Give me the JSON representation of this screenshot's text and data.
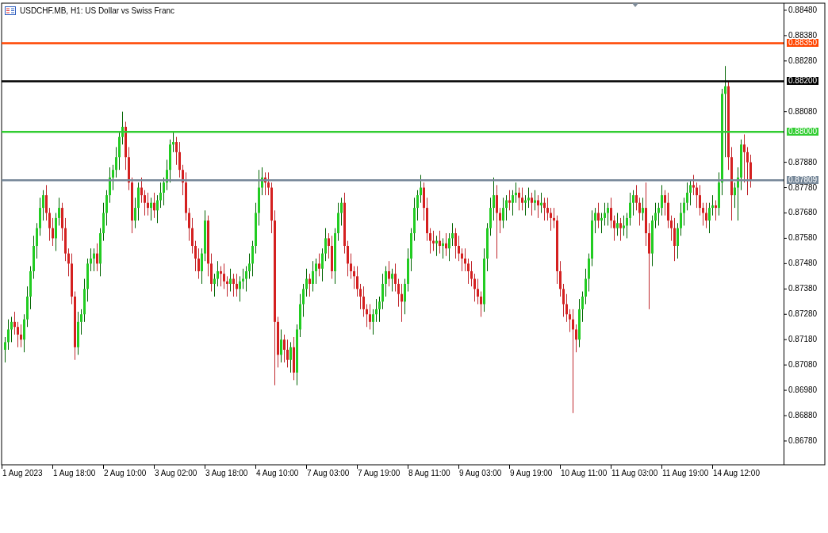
{
  "chart_title": "USDCHF.MB, H1:  US Dollar vs Swiss Franc",
  "time_axis": [
    "1 Aug 2023",
    "1 Aug 18:00",
    "2 Aug 10:00",
    "3 Aug 02:00",
    "3 Aug 18:00",
    "4 Aug 10:00",
    "7 Aug 03:00",
    "7 Aug 19:00",
    "8 Aug 11:00",
    "9 Aug 03:00",
    "9 Aug 19:00",
    "10 Aug 11:00",
    "11 Aug 03:00",
    "11 Aug 19:00",
    "14 Aug 12:00"
  ],
  "chart_data": {
    "type": "candlestick",
    "ref_lines": [
      {
        "axis": "y",
        "value": 0.8835,
        "label": "0.88350",
        "color": "#ff4500"
      },
      {
        "axis": "y",
        "value": 0.882,
        "label": "0.88200",
        "color": "#000000"
      },
      {
        "axis": "y",
        "value": 0.88,
        "label": "0.88000",
        "color": "#32cd32"
      },
      {
        "axis": "y",
        "value": 0.87809,
        "label": "0.87809",
        "color": "#778899"
      }
    ],
    "ylim": [
      0.86686,
      0.88508
    ],
    "yticks": [
      {
        "value": 0.8848,
        "label": "0.88480"
      },
      {
        "value": 0.8838,
        "label": "0.88380"
      },
      {
        "value": 0.8828,
        "label": "0.88280"
      },
      {
        "value": 0.8808,
        "label": "0.88080"
      },
      {
        "value": 0.8788,
        "label": "0.87880"
      },
      {
        "value": 0.8778,
        "label": "0.87780"
      },
      {
        "value": 0.8768,
        "label": "0.87680"
      },
      {
        "value": 0.8758,
        "label": "0.87580"
      },
      {
        "value": 0.8748,
        "label": "0.87480"
      },
      {
        "value": 0.8738,
        "label": "0.87380"
      },
      {
        "value": 0.8728,
        "label": "0.87280"
      },
      {
        "value": 0.8718,
        "label": "0.87180"
      },
      {
        "value": 0.8708,
        "label": "0.87080"
      },
      {
        "value": 0.8698,
        "label": "0.86980"
      },
      {
        "value": 0.8688,
        "label": "0.86880"
      },
      {
        "value": 0.8678,
        "label": "0.86780"
      }
    ],
    "ohlc": [
      [
        0.8714,
        0.8719,
        0.8709,
        0.8717
      ],
      [
        0.8717,
        0.8726,
        0.8714,
        0.8722
      ],
      [
        0.8722,
        0.8727,
        0.8717,
        0.8725
      ],
      [
        0.8725,
        0.8729,
        0.872,
        0.8723
      ],
      [
        0.8723,
        0.8725,
        0.8715,
        0.872
      ],
      [
        0.872,
        0.8724,
        0.8715,
        0.8718
      ],
      [
        0.8718,
        0.8728,
        0.8713,
        0.8726
      ],
      [
        0.8726,
        0.8739,
        0.8723,
        0.8735
      ],
      [
        0.8735,
        0.8747,
        0.873,
        0.8745
      ],
      [
        0.8745,
        0.8759,
        0.8742,
        0.8755
      ],
      [
        0.8755,
        0.8764,
        0.875,
        0.8762
      ],
      [
        0.8762,
        0.8774,
        0.8759,
        0.877
      ],
      [
        0.877,
        0.8777,
        0.8765,
        0.8775
      ],
      [
        0.8775,
        0.8779,
        0.8765,
        0.8768
      ],
      [
        0.8768,
        0.877,
        0.8757,
        0.8762
      ],
      [
        0.8762,
        0.8766,
        0.8755,
        0.8758
      ],
      [
        0.8758,
        0.8768,
        0.8753,
        0.8766
      ],
      [
        0.8766,
        0.8774,
        0.8763,
        0.877
      ],
      [
        0.877,
        0.8772,
        0.8757,
        0.8762
      ],
      [
        0.8762,
        0.8766,
        0.8749,
        0.8752
      ],
      [
        0.8752,
        0.8754,
        0.8743,
        0.8748
      ],
      [
        0.8748,
        0.8752,
        0.8732,
        0.8735
      ],
      [
        0.8735,
        0.8737,
        0.871,
        0.8715
      ],
      [
        0.8715,
        0.8729,
        0.8712,
        0.8725
      ],
      [
        0.8725,
        0.873,
        0.872,
        0.8728
      ],
      [
        0.8728,
        0.8742,
        0.8725,
        0.8738
      ],
      [
        0.8738,
        0.875,
        0.8733,
        0.8748
      ],
      [
        0.8748,
        0.8754,
        0.8745,
        0.875
      ],
      [
        0.875,
        0.8754,
        0.8745,
        0.8752
      ],
      [
        0.8752,
        0.8756,
        0.8745,
        0.8748
      ],
      [
        0.8748,
        0.8762,
        0.8743,
        0.876
      ],
      [
        0.876,
        0.8772,
        0.8757,
        0.8768
      ],
      [
        0.8768,
        0.8777,
        0.8763,
        0.8775
      ],
      [
        0.8775,
        0.8786,
        0.8772,
        0.8782
      ],
      [
        0.8782,
        0.8787,
        0.8777,
        0.8785
      ],
      [
        0.8785,
        0.8794,
        0.8782,
        0.879
      ],
      [
        0.879,
        0.88,
        0.8785,
        0.8798
      ],
      [
        0.8798,
        0.8808,
        0.8795,
        0.8802
      ],
      [
        0.8802,
        0.8804,
        0.8785,
        0.879
      ],
      [
        0.879,
        0.8794,
        0.8777,
        0.878
      ],
      [
        0.878,
        0.8782,
        0.876,
        0.8765
      ],
      [
        0.8765,
        0.8774,
        0.8762,
        0.877
      ],
      [
        0.877,
        0.878,
        0.8765,
        0.8778
      ],
      [
        0.8778,
        0.8782,
        0.8772,
        0.8775
      ],
      [
        0.8775,
        0.8777,
        0.8767,
        0.8772
      ],
      [
        0.8772,
        0.8776,
        0.8767,
        0.877
      ],
      [
        0.877,
        0.8774,
        0.8765,
        0.8772
      ],
      [
        0.8772,
        0.8776,
        0.8766,
        0.8769
      ],
      [
        0.8769,
        0.8775,
        0.8764,
        0.8773
      ],
      [
        0.8773,
        0.878,
        0.877,
        0.8776
      ],
      [
        0.8776,
        0.8782,
        0.8771,
        0.878
      ],
      [
        0.878,
        0.8789,
        0.8777,
        0.8785
      ],
      [
        0.8785,
        0.8797,
        0.878,
        0.8795
      ],
      [
        0.8795,
        0.88,
        0.8792,
        0.8796
      ],
      [
        0.8796,
        0.8798,
        0.8787,
        0.8792
      ],
      [
        0.8792,
        0.8796,
        0.8782,
        0.8785
      ],
      [
        0.8785,
        0.8787,
        0.8775,
        0.878
      ],
      [
        0.878,
        0.8784,
        0.8765,
        0.8768
      ],
      [
        0.8768,
        0.877,
        0.8757,
        0.8762
      ],
      [
        0.8762,
        0.8766,
        0.8752,
        0.8755
      ],
      [
        0.8755,
        0.8757,
        0.8745,
        0.875
      ],
      [
        0.875,
        0.8754,
        0.8742,
        0.8745
      ],
      [
        0.8745,
        0.8754,
        0.874,
        0.8752
      ],
      [
        0.8752,
        0.8769,
        0.8749,
        0.8765
      ],
      [
        0.8765,
        0.8767,
        0.8743,
        0.8748
      ],
      [
        0.8748,
        0.8752,
        0.8737,
        0.874
      ],
      [
        0.874,
        0.8744,
        0.8735,
        0.8742
      ],
      [
        0.8742,
        0.8749,
        0.8739,
        0.8745
      ],
      [
        0.8745,
        0.8747,
        0.8739,
        0.8744
      ],
      [
        0.8744,
        0.8748,
        0.8738,
        0.8741
      ],
      [
        0.8741,
        0.8743,
        0.8735,
        0.874
      ],
      [
        0.874,
        0.8746,
        0.8737,
        0.8742
      ],
      [
        0.8742,
        0.8744,
        0.8735,
        0.874
      ],
      [
        0.874,
        0.8744,
        0.8735,
        0.8738
      ],
      [
        0.8738,
        0.8743,
        0.8733,
        0.8741
      ],
      [
        0.8741,
        0.8746,
        0.8738,
        0.8742
      ],
      [
        0.8742,
        0.8747,
        0.8737,
        0.8745
      ],
      [
        0.8745,
        0.8752,
        0.8742,
        0.8748
      ],
      [
        0.8748,
        0.8757,
        0.8743,
        0.8755
      ],
      [
        0.8755,
        0.8772,
        0.8752,
        0.8768
      ],
      [
        0.8768,
        0.8785,
        0.8763,
        0.8778
      ],
      [
        0.8778,
        0.8786,
        0.8775,
        0.8782
      ],
      [
        0.8782,
        0.8784,
        0.8775,
        0.878
      ],
      [
        0.878,
        0.8784,
        0.8775,
        0.8778
      ],
      [
        0.8778,
        0.878,
        0.876,
        0.8765
      ],
      [
        0.8765,
        0.8769,
        0.87,
        0.8725
      ],
      [
        0.8725,
        0.8727,
        0.8707,
        0.8712
      ],
      [
        0.8712,
        0.8722,
        0.8709,
        0.8718
      ],
      [
        0.8718,
        0.872,
        0.8709,
        0.8714
      ],
      [
        0.8714,
        0.8718,
        0.8707,
        0.871
      ],
      [
        0.871,
        0.8717,
        0.8705,
        0.8715
      ],
      [
        0.8715,
        0.8719,
        0.8702,
        0.8705
      ],
      [
        0.8705,
        0.8724,
        0.87,
        0.8722
      ],
      [
        0.8722,
        0.8736,
        0.8719,
        0.8732
      ],
      [
        0.8732,
        0.874,
        0.8727,
        0.8738
      ],
      [
        0.8738,
        0.8746,
        0.8735,
        0.8742
      ],
      [
        0.8742,
        0.8744,
        0.8735,
        0.874
      ],
      [
        0.874,
        0.8749,
        0.8737,
        0.8745
      ],
      [
        0.8745,
        0.875,
        0.874,
        0.8748
      ],
      [
        0.8748,
        0.8752,
        0.8743,
        0.8746
      ],
      [
        0.8746,
        0.8754,
        0.8741,
        0.8752
      ],
      [
        0.8752,
        0.8762,
        0.8749,
        0.8758
      ],
      [
        0.8758,
        0.876,
        0.875,
        0.8755
      ],
      [
        0.8755,
        0.8759,
        0.8742,
        0.8745
      ],
      [
        0.8745,
        0.8762,
        0.874,
        0.876
      ],
      [
        0.876,
        0.8772,
        0.8757,
        0.8768
      ],
      [
        0.8768,
        0.8774,
        0.8763,
        0.8772
      ],
      [
        0.8772,
        0.8776,
        0.8752,
        0.8755
      ],
      [
        0.8755,
        0.8757,
        0.8743,
        0.8748
      ],
      [
        0.8748,
        0.8752,
        0.8742,
        0.8745
      ],
      [
        0.8745,
        0.8747,
        0.8738,
        0.8743
      ],
      [
        0.8743,
        0.8747,
        0.8735,
        0.8738
      ],
      [
        0.8738,
        0.874,
        0.873,
        0.8735
      ],
      [
        0.8735,
        0.8739,
        0.8727,
        0.873
      ],
      [
        0.873,
        0.8732,
        0.8723,
        0.8728
      ],
      [
        0.8728,
        0.8732,
        0.8722,
        0.8725
      ],
      [
        0.8725,
        0.873,
        0.872,
        0.8728
      ],
      [
        0.8728,
        0.8734,
        0.8725,
        0.873
      ],
      [
        0.873,
        0.8735,
        0.8725,
        0.8733
      ],
      [
        0.8733,
        0.8744,
        0.873,
        0.874
      ],
      [
        0.874,
        0.8747,
        0.8735,
        0.8745
      ],
      [
        0.8745,
        0.8749,
        0.8739,
        0.8742
      ],
      [
        0.8742,
        0.8746,
        0.8737,
        0.8744
      ],
      [
        0.8744,
        0.8748,
        0.8737,
        0.874
      ],
      [
        0.874,
        0.8742,
        0.8731,
        0.8736
      ],
      [
        0.8736,
        0.874,
        0.8725,
        0.8733
      ],
      [
        0.8733,
        0.8742,
        0.8728,
        0.874
      ],
      [
        0.874,
        0.8754,
        0.8737,
        0.875
      ],
      [
        0.875,
        0.8762,
        0.8745,
        0.876
      ],
      [
        0.876,
        0.8774,
        0.8757,
        0.877
      ],
      [
        0.877,
        0.8777,
        0.8765,
        0.8775
      ],
      [
        0.8775,
        0.8783,
        0.8772,
        0.8778
      ],
      [
        0.8778,
        0.878,
        0.8765,
        0.877
      ],
      [
        0.877,
        0.8774,
        0.8757,
        0.876
      ],
      [
        0.876,
        0.8762,
        0.8752,
        0.8757
      ],
      [
        0.8757,
        0.8761,
        0.8753,
        0.8756
      ],
      [
        0.8756,
        0.8759,
        0.8751,
        0.8757
      ],
      [
        0.8757,
        0.8761,
        0.8752,
        0.8755
      ],
      [
        0.8755,
        0.8758,
        0.875,
        0.8756
      ],
      [
        0.8756,
        0.876,
        0.8751,
        0.8754
      ],
      [
        0.8754,
        0.876,
        0.8749,
        0.8758
      ],
      [
        0.8758,
        0.8764,
        0.8755,
        0.876
      ],
      [
        0.876,
        0.8762,
        0.875,
        0.8755
      ],
      [
        0.8755,
        0.8759,
        0.8749,
        0.8752
      ],
      [
        0.8752,
        0.8754,
        0.8745,
        0.875
      ],
      [
        0.875,
        0.8754,
        0.8745,
        0.8748
      ],
      [
        0.8748,
        0.875,
        0.874,
        0.8745
      ],
      [
        0.8745,
        0.8749,
        0.8739,
        0.8742
      ],
      [
        0.8742,
        0.8744,
        0.8733,
        0.8738
      ],
      [
        0.8738,
        0.8742,
        0.8732,
        0.8735
      ],
      [
        0.8735,
        0.8737,
        0.8727,
        0.8732
      ],
      [
        0.8732,
        0.8754,
        0.8729,
        0.875
      ],
      [
        0.875,
        0.8764,
        0.8745,
        0.8762
      ],
      [
        0.8762,
        0.8774,
        0.8759,
        0.877
      ],
      [
        0.877,
        0.8782,
        0.8765,
        0.8775
      ],
      [
        0.8775,
        0.8779,
        0.875,
        0.8768
      ],
      [
        0.8768,
        0.877,
        0.876,
        0.8765
      ],
      [
        0.8765,
        0.8774,
        0.8762,
        0.877
      ],
      [
        0.877,
        0.8775,
        0.8765,
        0.8773
      ],
      [
        0.8773,
        0.8777,
        0.8769,
        0.8772
      ],
      [
        0.8772,
        0.8777,
        0.8767,
        0.8775
      ],
      [
        0.8775,
        0.878,
        0.8772,
        0.8776
      ],
      [
        0.8776,
        0.8778,
        0.8769,
        0.8774
      ],
      [
        0.8774,
        0.8778,
        0.8769,
        0.8772
      ],
      [
        0.8772,
        0.8775,
        0.8767,
        0.8773
      ],
      [
        0.8773,
        0.8778,
        0.877,
        0.8774
      ],
      [
        0.8774,
        0.8776,
        0.8767,
        0.8772
      ],
      [
        0.8772,
        0.8777,
        0.8769,
        0.8773
      ],
      [
        0.8773,
        0.8775,
        0.8766,
        0.8771
      ],
      [
        0.8771,
        0.8776,
        0.8768,
        0.8772
      ],
      [
        0.8772,
        0.8774,
        0.8765,
        0.877
      ],
      [
        0.877,
        0.8774,
        0.8765,
        0.8768
      ],
      [
        0.8768,
        0.877,
        0.8761,
        0.8766
      ],
      [
        0.8766,
        0.877,
        0.8762,
        0.8765
      ],
      [
        0.8765,
        0.8767,
        0.874,
        0.8745
      ],
      [
        0.8745,
        0.8749,
        0.8735,
        0.8738
      ],
      [
        0.8738,
        0.874,
        0.8727,
        0.8732
      ],
      [
        0.8732,
        0.8736,
        0.8725,
        0.8728
      ],
      [
        0.8728,
        0.873,
        0.8721,
        0.8726
      ],
      [
        0.8726,
        0.873,
        0.8689,
        0.8722
      ],
      [
        0.8722,
        0.8724,
        0.8713,
        0.8718
      ],
      [
        0.8718,
        0.8734,
        0.8715,
        0.873
      ],
      [
        0.873,
        0.8737,
        0.8725,
        0.8735
      ],
      [
        0.8735,
        0.8746,
        0.8732,
        0.8742
      ],
      [
        0.8742,
        0.8752,
        0.8737,
        0.875
      ],
      [
        0.875,
        0.8769,
        0.8747,
        0.8765
      ],
      [
        0.8765,
        0.877,
        0.876,
        0.8768
      ],
      [
        0.8768,
        0.8772,
        0.8762,
        0.8765
      ],
      [
        0.8765,
        0.8768,
        0.876,
        0.8766
      ],
      [
        0.8766,
        0.8772,
        0.8763,
        0.8768
      ],
      [
        0.8768,
        0.8772,
        0.8763,
        0.877
      ],
      [
        0.877,
        0.8774,
        0.8762,
        0.8765
      ],
      [
        0.8765,
        0.8767,
        0.8757,
        0.8762
      ],
      [
        0.8762,
        0.8768,
        0.8759,
        0.8764
      ],
      [
        0.8764,
        0.8766,
        0.8757,
        0.8762
      ],
      [
        0.8762,
        0.8767,
        0.8759,
        0.8763
      ],
      [
        0.8763,
        0.8768,
        0.8758,
        0.8766
      ],
      [
        0.8766,
        0.8776,
        0.8763,
        0.8772
      ],
      [
        0.8772,
        0.8777,
        0.8767,
        0.8775
      ],
      [
        0.8775,
        0.8779,
        0.8769,
        0.8772
      ],
      [
        0.8772,
        0.8774,
        0.8763,
        0.8768
      ],
      [
        0.8768,
        0.8774,
        0.8765,
        0.877
      ],
      [
        0.877,
        0.878,
        0.8755,
        0.876
      ],
      [
        0.876,
        0.8764,
        0.873,
        0.8752
      ],
      [
        0.8752,
        0.8767,
        0.8747,
        0.8765
      ],
      [
        0.8765,
        0.8772,
        0.8762,
        0.8768
      ],
      [
        0.8768,
        0.8772,
        0.8763,
        0.877
      ],
      [
        0.877,
        0.8779,
        0.8767,
        0.8775
      ],
      [
        0.8775,
        0.8777,
        0.8767,
        0.8772
      ],
      [
        0.8772,
        0.8776,
        0.8762,
        0.8765
      ],
      [
        0.8765,
        0.8767,
        0.8757,
        0.8762
      ],
      [
        0.8762,
        0.8766,
        0.8749,
        0.8755
      ],
      [
        0.8755,
        0.8764,
        0.875,
        0.8762
      ],
      [
        0.8762,
        0.8772,
        0.8759,
        0.8768
      ],
      [
        0.8768,
        0.8774,
        0.8763,
        0.8772
      ],
      [
        0.8772,
        0.878,
        0.8769,
        0.8776
      ],
      [
        0.8776,
        0.8781,
        0.8771,
        0.8779
      ],
      [
        0.8779,
        0.8783,
        0.8775,
        0.8778
      ],
      [
        0.8778,
        0.878,
        0.877,
        0.8775
      ],
      [
        0.8775,
        0.8779,
        0.8767,
        0.877
      ],
      [
        0.877,
        0.8772,
        0.8763,
        0.8768
      ],
      [
        0.8768,
        0.8772,
        0.8762,
        0.8765
      ],
      [
        0.8765,
        0.8772,
        0.876,
        0.877
      ],
      [
        0.877,
        0.8775,
        0.8767,
        0.8771
      ],
      [
        0.8771,
        0.8773,
        0.8765,
        0.877
      ],
      [
        0.877,
        0.8784,
        0.8767,
        0.878
      ],
      [
        0.878,
        0.8817,
        0.8775,
        0.8815
      ],
      [
        0.8815,
        0.8826,
        0.879,
        0.8818
      ],
      [
        0.8818,
        0.882,
        0.8785,
        0.879
      ],
      [
        0.879,
        0.8794,
        0.8765,
        0.8775
      ],
      [
        0.8775,
        0.878,
        0.877,
        0.8778
      ],
      [
        0.8778,
        0.8786,
        0.8765,
        0.8782
      ],
      [
        0.8782,
        0.8797,
        0.8777,
        0.8795
      ],
      [
        0.8795,
        0.8799,
        0.878,
        0.8792
      ],
      [
        0.8792,
        0.8794,
        0.8775,
        0.8788
      ],
      [
        0.8788,
        0.8791,
        0.8778,
        0.8781
      ]
    ]
  }
}
